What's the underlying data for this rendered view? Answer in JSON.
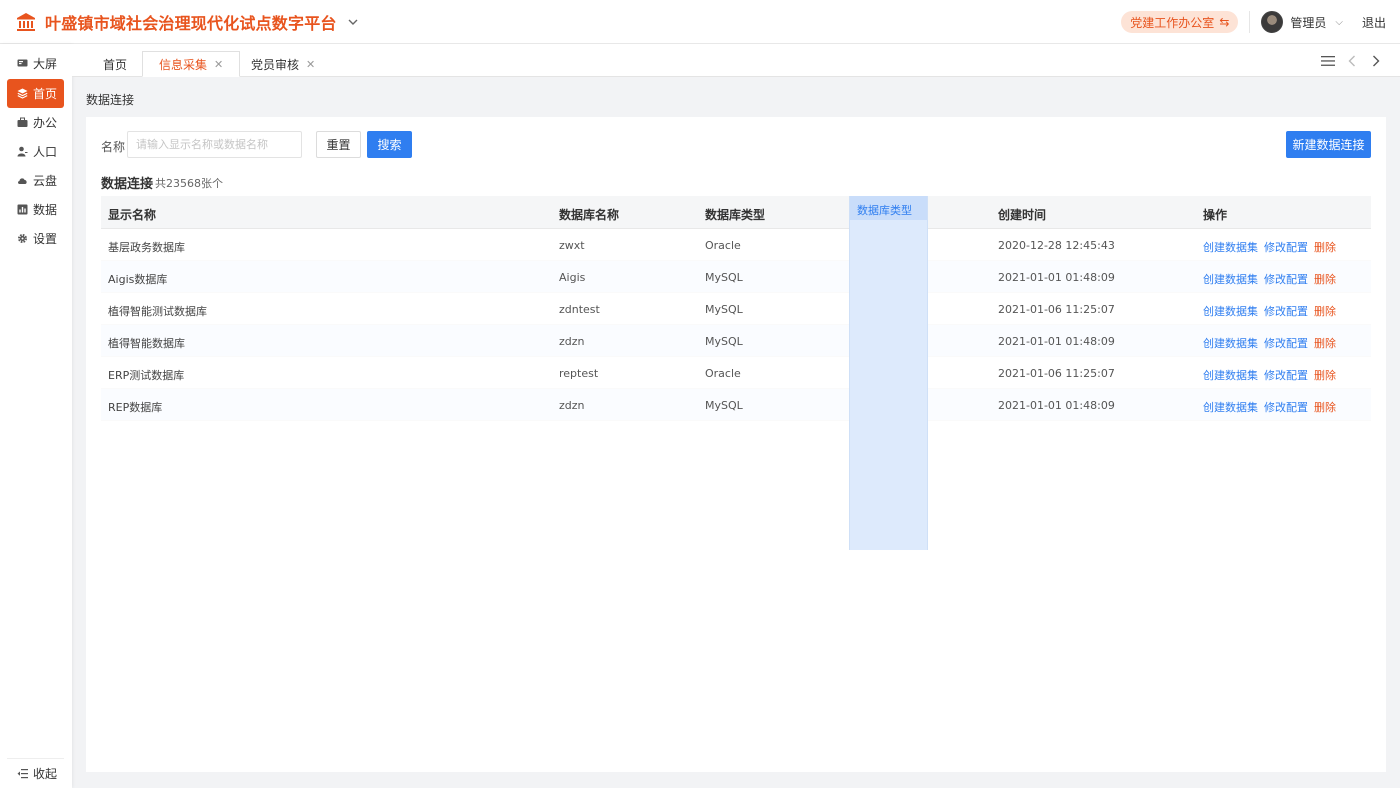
{
  "header": {
    "title": "叶盛镇市域社会治理现代化试点数字平台",
    "office_label": "党建工作办公室",
    "office_icon": "swap-icon",
    "user_name": "管理员",
    "logout_label": "退出",
    "accent_color": "#e8541e"
  },
  "sidebar": {
    "items": [
      {
        "label": "大屏",
        "icon": "screen-icon"
      },
      {
        "label": "首页",
        "icon": "layers-icon",
        "active": true
      },
      {
        "label": "办公",
        "icon": "briefcase-icon"
      },
      {
        "label": "人口",
        "icon": "person-icon"
      },
      {
        "label": "云盘",
        "icon": "cloud-icon"
      },
      {
        "label": "数据",
        "icon": "chart-icon"
      },
      {
        "label": "设置",
        "icon": "gear-icon"
      }
    ],
    "collapse_label": "收起"
  },
  "tabs": [
    {
      "label": "首页",
      "closable": false
    },
    {
      "label": "信息采集",
      "closable": true,
      "active": true
    },
    {
      "label": "党员审核",
      "closable": true
    }
  ],
  "breadcrumb": "数据连接",
  "search": {
    "label": "名称",
    "placeholder": "请输入显示名称或数据名称",
    "value": "",
    "reset_label": "重置",
    "search_label": "搜索",
    "new_label": "新建数据连接"
  },
  "list": {
    "title": "数据连接",
    "count_text": "共23568张个",
    "columns": [
      "显示名称",
      "数据库名称",
      "数据库类型",
      "创建时间",
      "操作"
    ],
    "dragging_column": "数据库类型",
    "actions": {
      "create": "创建数据集",
      "edit": "修改配置",
      "delete": "删除"
    },
    "rows": [
      {
        "name": "基层政务数据库",
        "db": "zwxt",
        "type": "Oracle",
        "created": "2020-12-28 12:45:43"
      },
      {
        "name": "Aigis数据库",
        "db": "Aigis",
        "type": "MySQL",
        "created": "2021-01-01 01:48:09"
      },
      {
        "name": "植得智能测试数据库",
        "db": "zdntest",
        "type": "MySQL",
        "created": "2021-01-06 11:25:07"
      },
      {
        "name": "植得智能数据库",
        "db": "zdzn",
        "type": "MySQL",
        "created": "2021-01-01 01:48:09"
      },
      {
        "name": "ERP测试数据库",
        "db": "reptest",
        "type": "Oracle",
        "created": "2021-01-06 11:25:07"
      },
      {
        "name": "REP数据库",
        "db": "zdzn",
        "type": "MySQL",
        "created": "2021-01-01 01:48:09"
      }
    ]
  },
  "colors": {
    "primary": "#2f7ef0",
    "accent": "#e8541e",
    "danger": "#e8541e"
  }
}
